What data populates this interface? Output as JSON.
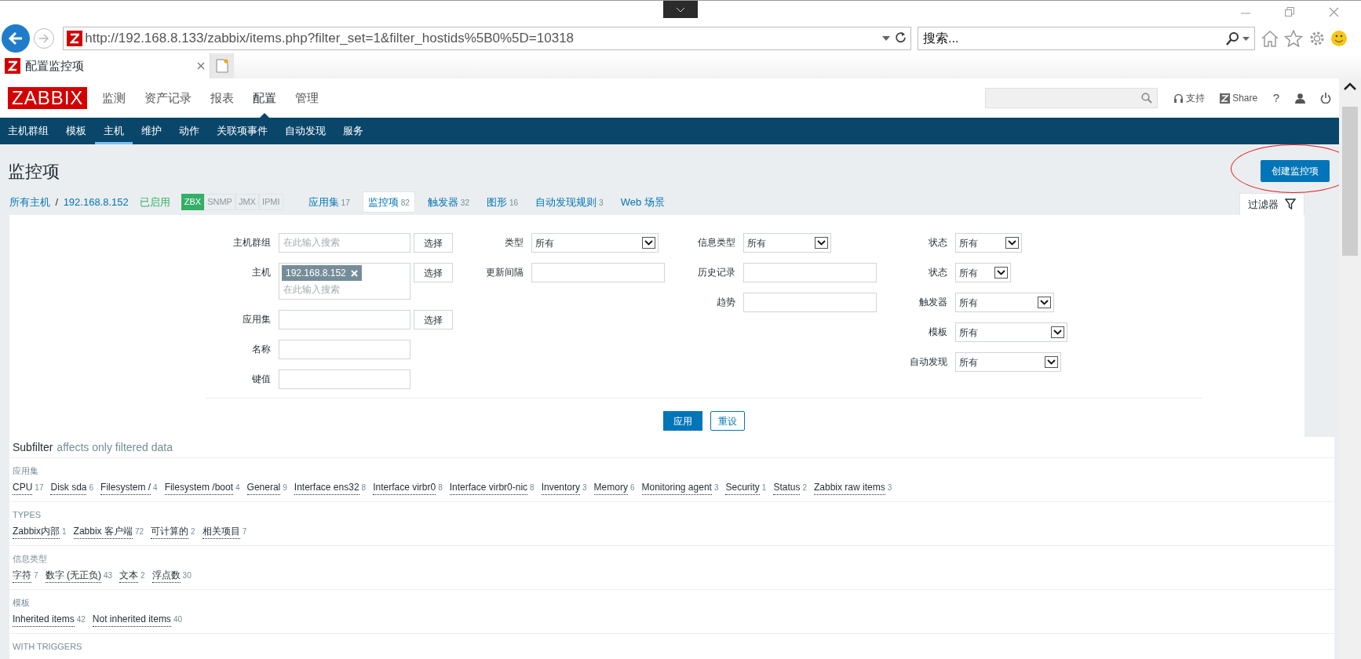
{
  "browser": {
    "url": "http://192.168.8.133/zabbix/items.php?filter_set=1&filter_hostids%5B0%5D=10318",
    "search_placeholder": "搜索...",
    "tab_title": "配置监控项"
  },
  "header": {
    "logo": "ZABBIX",
    "support": "支持",
    "share": "Share",
    "help": "?",
    "main_menu": [
      {
        "label": "监测",
        "selected": false
      },
      {
        "label": "资产记录",
        "selected": false
      },
      {
        "label": "报表",
        "selected": false
      },
      {
        "label": "配置",
        "selected": true
      },
      {
        "label": "管理",
        "selected": false
      }
    ],
    "sub_menu": [
      {
        "label": "主机群组",
        "selected": false
      },
      {
        "label": "模板",
        "selected": false
      },
      {
        "label": "主机",
        "selected": true
      },
      {
        "label": "维护",
        "selected": false
      },
      {
        "label": "动作",
        "selected": false
      },
      {
        "label": "关联项事件",
        "selected": false
      },
      {
        "label": "自动发现",
        "selected": false
      },
      {
        "label": "服务",
        "selected": false
      }
    ]
  },
  "page_title": "监控项",
  "create_button": "创建监控项",
  "breadcrumbs": {
    "all_hosts": "所有主机",
    "separator": "/",
    "host": "192.168.8.152",
    "status": "已启用",
    "availability": [
      {
        "label": "ZBX",
        "active": true
      },
      {
        "label": "SNMP",
        "active": false
      },
      {
        "label": "JMX",
        "active": false
      },
      {
        "label": "IPMI",
        "active": false
      }
    ],
    "links": [
      {
        "label": "应用集",
        "count": "17",
        "selected": false
      },
      {
        "label": "监控项",
        "count": "82",
        "selected": true
      },
      {
        "label": "触发器",
        "count": "32",
        "selected": false
      },
      {
        "label": "图形",
        "count": "16",
        "selected": false
      },
      {
        "label": "自动发现规则",
        "count": "3",
        "selected": false
      },
      {
        "label": "Web 场景",
        "selected": false
      }
    ]
  },
  "filter": {
    "tab": "过滤器",
    "apply": "应用",
    "reset": "重设",
    "columns": [
      [
        {
          "label": "主机群组",
          "kind": "multiselect",
          "placeholder": "在此输入搜索",
          "button": "选择"
        },
        {
          "label": "主机",
          "kind": "multiselect",
          "tags": [
            "192.168.8.152"
          ],
          "placeholder": "在此输入搜索",
          "button": "选择"
        },
        {
          "label": "应用集",
          "kind": "text",
          "button": "选择"
        },
        {
          "label": "名称",
          "kind": "text"
        },
        {
          "label": "键值",
          "kind": "text"
        }
      ],
      [
        {
          "label": "类型",
          "kind": "select",
          "value": "所有"
        },
        {
          "label": "更新间隔",
          "kind": "text"
        }
      ],
      [
        {
          "label": "信息类型",
          "kind": "select",
          "value": "所有"
        },
        {
          "label": "历史记录",
          "kind": "text"
        },
        {
          "label": "趋势",
          "kind": "text"
        }
      ],
      [
        {
          "label": "状态",
          "kind": "select",
          "value": "所有"
        },
        {
          "label": "状态",
          "kind": "select",
          "value": "所有"
        },
        {
          "label": "触发器",
          "kind": "select",
          "value": "所有"
        },
        {
          "label": "模板",
          "kind": "select",
          "value": "所有"
        },
        {
          "label": "自动发现",
          "kind": "select",
          "value": "所有"
        }
      ]
    ]
  },
  "subfilter": {
    "title": "Subfilter",
    "note": "affects only filtered data",
    "groups": [
      {
        "heading": "应用集",
        "items": [
          {
            "label": "CPU",
            "count": "17"
          },
          {
            "label": "Disk sda",
            "count": "6"
          },
          {
            "label": "Filesystem /",
            "count": "4"
          },
          {
            "label": "Filesystem /boot",
            "count": "4"
          },
          {
            "label": "General",
            "count": "9"
          },
          {
            "label": "Interface ens32",
            "count": "8"
          },
          {
            "label": "Interface virbr0",
            "count": "8"
          },
          {
            "label": "Interface virbr0-nic",
            "count": "8"
          },
          {
            "label": "Inventory",
            "count": "3"
          },
          {
            "label": "Memory",
            "count": "6"
          },
          {
            "label": "Monitoring agent",
            "count": "3"
          },
          {
            "label": "Security",
            "count": "1"
          },
          {
            "label": "Status",
            "count": "2"
          },
          {
            "label": "Zabbix raw items",
            "count": "3"
          }
        ]
      },
      {
        "heading": "TYPES",
        "items": [
          {
            "label": "Zabbix内部",
            "count": "1"
          },
          {
            "label": "Zabbix 客户端",
            "count": "72"
          },
          {
            "label": "可计算的",
            "count": "2"
          },
          {
            "label": "相关项目",
            "count": "7"
          }
        ]
      },
      {
        "heading": "信息类型",
        "items": [
          {
            "label": "字符",
            "count": "7"
          },
          {
            "label": "数字 (无正负)",
            "count": "43"
          },
          {
            "label": "文本",
            "count": "2"
          },
          {
            "label": "浮点数",
            "count": "30"
          }
        ]
      },
      {
        "heading": "模板",
        "items": [
          {
            "label": "Inherited items",
            "count": "42"
          },
          {
            "label": "Not inherited items",
            "count": "40"
          }
        ]
      },
      {
        "heading": "WITH TRIGGERS"
      }
    ]
  }
}
